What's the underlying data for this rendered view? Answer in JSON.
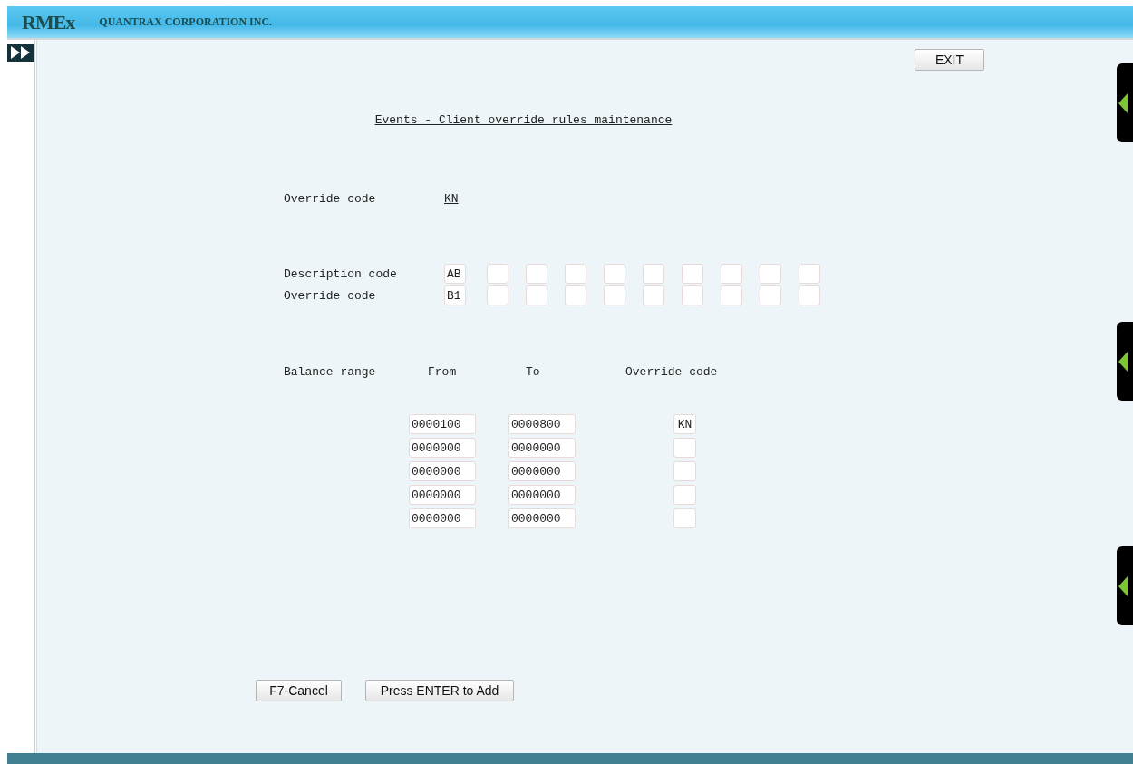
{
  "header": {
    "logo": "RMEx",
    "company": "QUANTRAX CORPORATION INC."
  },
  "exit_button": "EXIT",
  "title": "Events - Client override rules maintenance",
  "override_code": {
    "label": "Override code",
    "value": "KN"
  },
  "code_rows": [
    {
      "label": "Description code",
      "values": [
        "AB"
      ]
    },
    {
      "label": "Override code",
      "values": [
        "B1"
      ]
    }
  ],
  "range_headers": [
    "Balance range",
    "From",
    "To",
    "Override code"
  ],
  "ranges": [
    {
      "from": "0000100",
      "to": "0000800",
      "override_code": "KN"
    },
    {
      "from": "0000000",
      "to": "0000000"
    },
    {
      "from": "0000000",
      "to": "0000000"
    },
    {
      "from": "0000000",
      "to": "0000000"
    },
    {
      "from": "0000000",
      "to": "0000000"
    }
  ],
  "buttons": [
    "F7-Cancel",
    "Press ENTER to Add"
  ]
}
